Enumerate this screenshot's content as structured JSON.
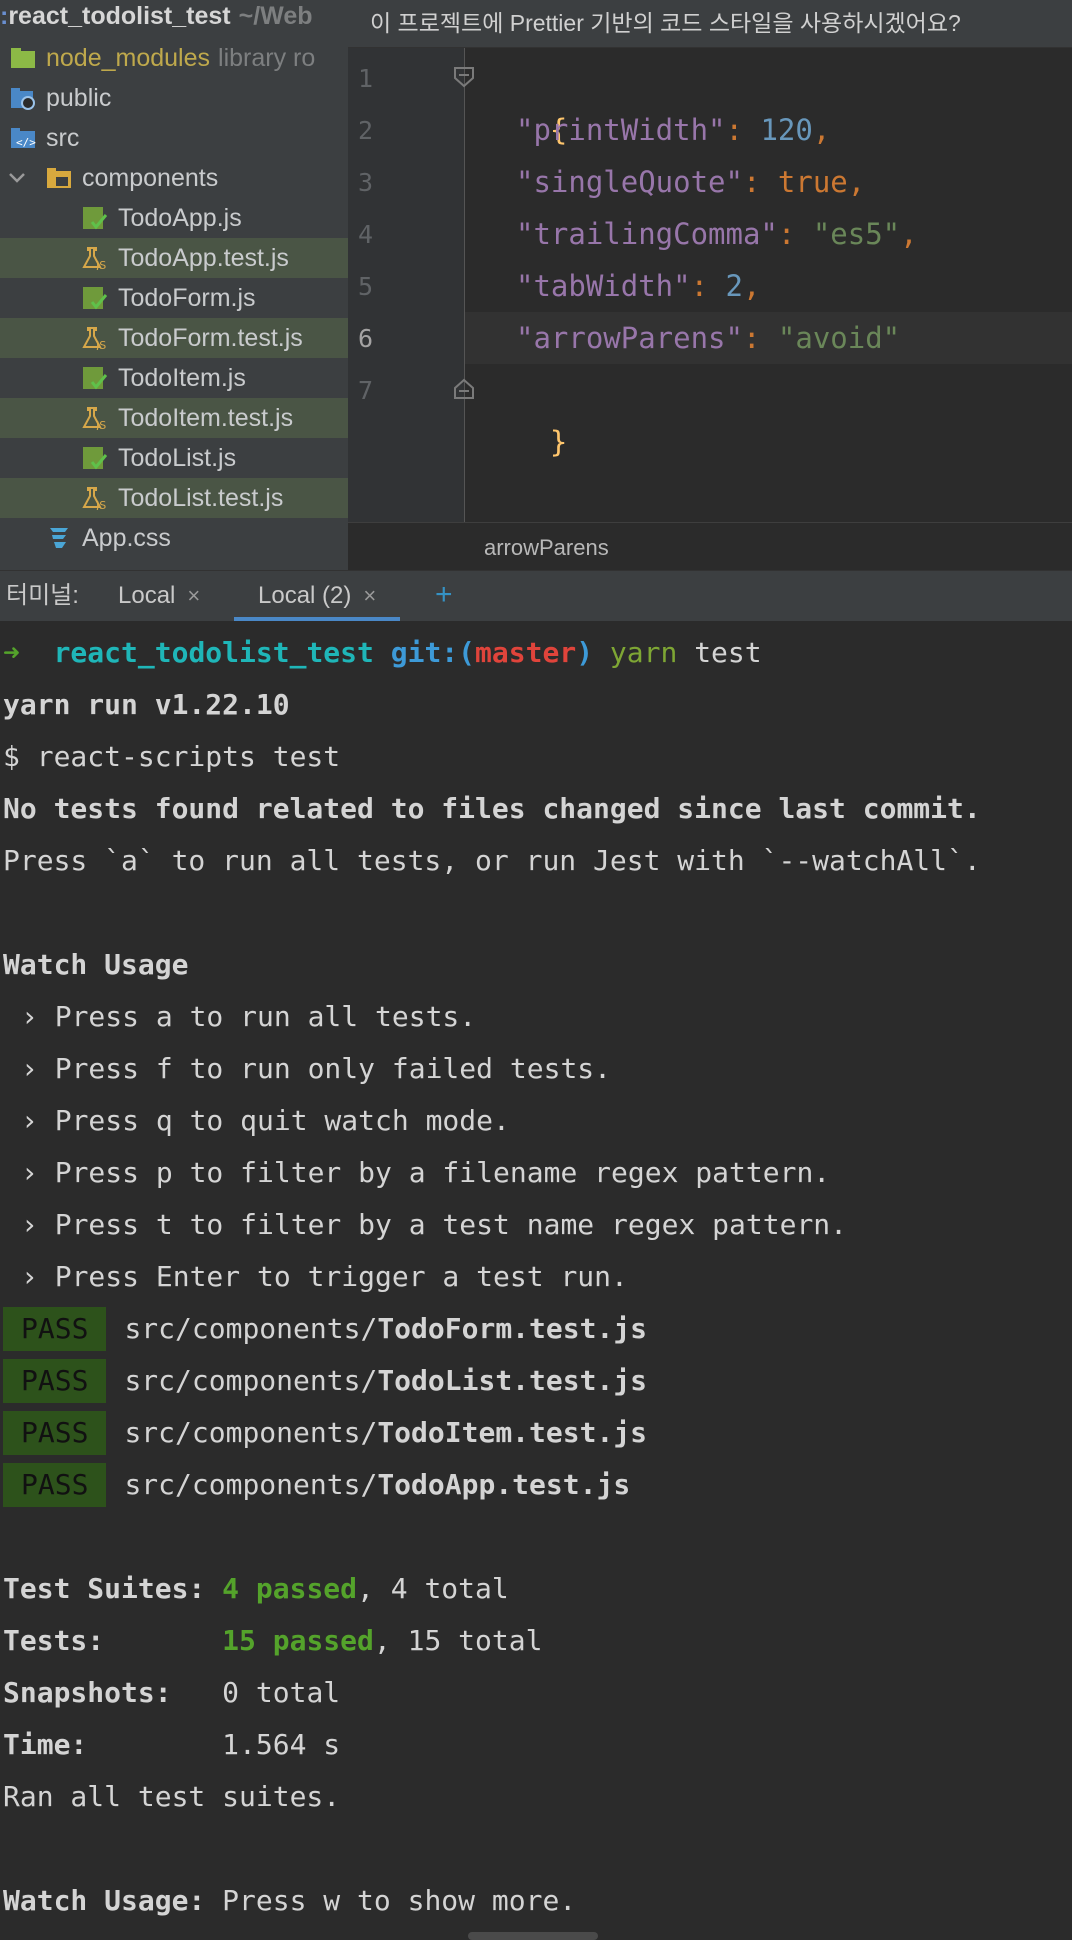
{
  "sidebar": {
    "root": {
      "name": "react_todolist_test",
      "hint": "~/Web"
    },
    "items": [
      {
        "name": "node_modules",
        "hint": "library ro"
      },
      {
        "name": "public"
      },
      {
        "name": "src"
      },
      {
        "name": "components"
      },
      {
        "name": "TodoApp.js"
      },
      {
        "name": "TodoApp.test.js"
      },
      {
        "name": "TodoForm.js"
      },
      {
        "name": "TodoForm.test.js"
      },
      {
        "name": "TodoItem.js"
      },
      {
        "name": "TodoItem.test.js"
      },
      {
        "name": "TodoList.js"
      },
      {
        "name": "TodoList.test.js"
      },
      {
        "name": "App.css"
      }
    ]
  },
  "editor": {
    "banner": "이 프로젝트에 Prettier 기반의 코드 스타일을 사용하시겠어요?",
    "line_numbers": [
      "1",
      "2",
      "3",
      "4",
      "5",
      "6",
      "7"
    ],
    "open_brace": "{",
    "close_brace": "}",
    "props": [
      {
        "key": "\"printWidth\"",
        "value": "120",
        "comma": ","
      },
      {
        "key": "\"singleQuote\"",
        "value": "true",
        "comma": ","
      },
      {
        "key": "\"trailingComma\"",
        "value": "\"es5\"",
        "comma": ","
      },
      {
        "key": "\"tabWidth\"",
        "value": "2",
        "comma": ","
      },
      {
        "key": "\"arrowParens\"",
        "value": "\"avoid\"",
        "comma": ""
      }
    ],
    "colon": ": ",
    "breadcrumb": "arrowParens"
  },
  "terminal": {
    "title": "터미널:",
    "tabs": [
      "Local",
      "Local (2)"
    ],
    "close": "×",
    "add": "+",
    "prompt": {
      "arrow": "➜",
      "dir": "react_todolist_test",
      "git": "git:(",
      "branch": "master",
      "git_close": ")",
      "cmd": "yarn",
      "arg": "test"
    },
    "lines": {
      "yarn_version": "yarn run v1.22.10",
      "react_scripts": "$ react-scripts test",
      "no_tests": "No tests found related to files changed since last commit.",
      "press_a": "Press `a` to run all tests, or run Jest with `--watchAll`.",
      "watch_usage": "Watch Usage",
      "usage": [
        "› Press a to run all tests.",
        "› Press f to run only failed tests.",
        "› Press q to quit watch mode.",
        "› Press p to filter by a filename regex pattern.",
        "› Press t to filter by a test name regex pattern.",
        "› Press Enter to trigger a test run."
      ],
      "pass_label": "PASS",
      "results": [
        {
          "dir": "src/components/",
          "file": "TodoForm.test.js"
        },
        {
          "dir": "src/components/",
          "file": "TodoList.test.js"
        },
        {
          "dir": "src/components/",
          "file": "TodoItem.test.js"
        },
        {
          "dir": "src/components/",
          "file": "TodoApp.test.js"
        }
      ],
      "suites_label": "Test Suites: ",
      "suites_passed": "4 passed",
      "suites_total": ", 4 total",
      "tests_label": "Tests:       ",
      "tests_passed": "15 passed",
      "tests_total": ", 15 total",
      "snapshots_label": "Snapshots:   ",
      "snapshots_value": "0 total",
      "time_label": "Time:        ",
      "time_value": "1.564 s",
      "ran_all": "Ran all test suites.",
      "watch_footer_label": "Watch Usage:",
      "watch_footer_text": " Press w to show more."
    }
  }
}
